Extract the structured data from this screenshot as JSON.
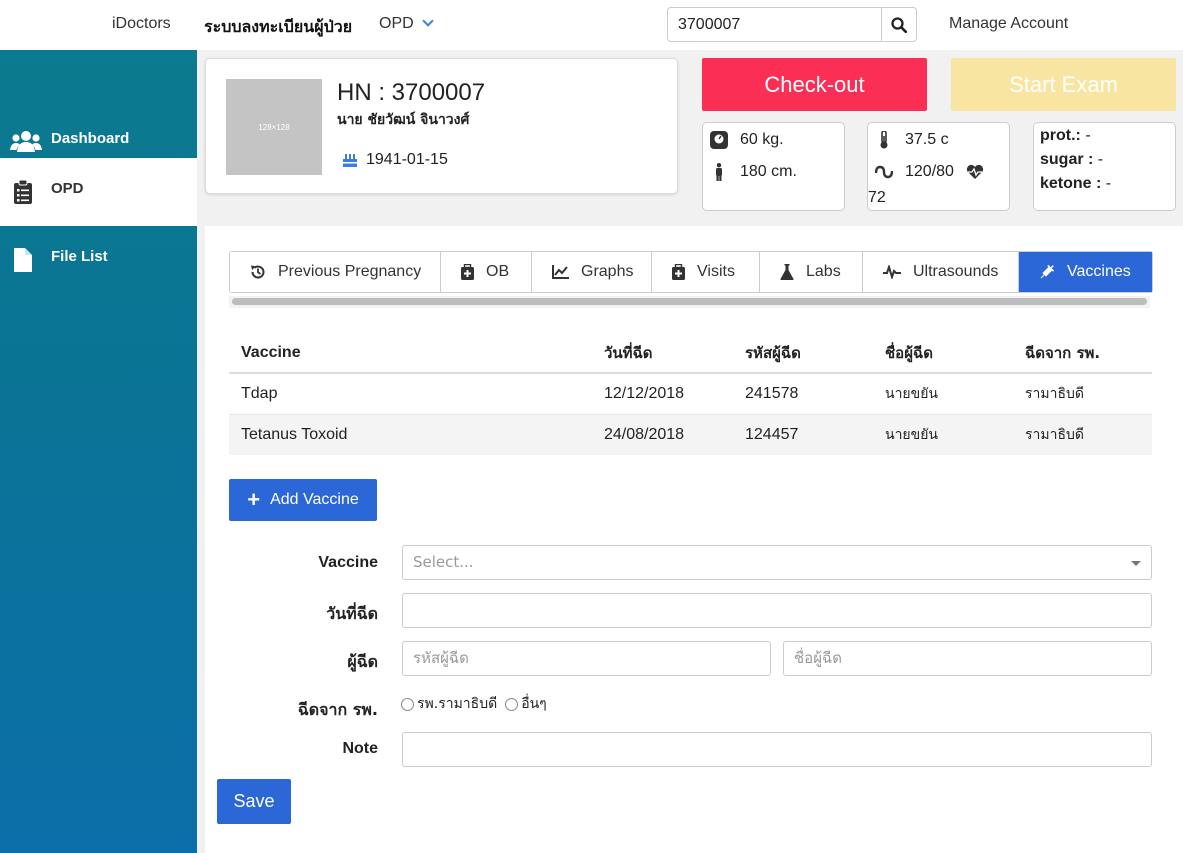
{
  "topbar": {
    "brand": "iDoctors",
    "register": "ระบบลงทะเบียนผู้ป่วย",
    "dept": "OPD",
    "search_value": "3700007",
    "manage": "Manage Account"
  },
  "sidebar": {
    "items": [
      {
        "label": "Dashboard",
        "icon": "users-icon"
      },
      {
        "label": "OPD",
        "icon": "clipboard-icon"
      },
      {
        "label": "File List",
        "icon": "file-icon"
      }
    ]
  },
  "patient": {
    "photo_placeholder": "128×128",
    "hn": "HN : 3700007",
    "name": "นาย ชัยวัฒน์ จินาวงศ์",
    "dob": "1941-01-15"
  },
  "actions": {
    "checkout": "Check-out",
    "start_exam": "Start Exam"
  },
  "vitals": {
    "weight": "60 kg.",
    "height": "180 cm.",
    "temp": "37.5 c",
    "bp": "120/80",
    "pulse": "72",
    "prot_label": "prot.:",
    "prot_value": "-",
    "sugar_label": "sugar :",
    "sugar_value": "-",
    "ketone_label": "ketone :",
    "ketone_value": "-"
  },
  "tabs": [
    {
      "label": "Previous Pregnancy",
      "icon": "history-icon"
    },
    {
      "label": "OB",
      "icon": "medkit-icon"
    },
    {
      "label": "Graphs",
      "icon": "line-chart-icon"
    },
    {
      "label": "Visits",
      "icon": "medkit-icon"
    },
    {
      "label": "Labs",
      "icon": "flask-icon"
    },
    {
      "label": "Ultrasounds",
      "icon": "heartbeat-line-icon"
    },
    {
      "label": "Vaccines",
      "icon": "syringe-icon"
    }
  ],
  "table": {
    "headers": [
      "Vaccine",
      "วันที่ฉีด",
      "รหัสผู้ฉีด",
      "ชื่อผู้ฉีด",
      "ฉีดจาก รพ."
    ],
    "rows": [
      [
        "Tdap",
        "12/12/2018",
        "241578",
        "นายขยัน",
        "รามาธิบดี"
      ],
      [
        "Tetanus Toxoid",
        "24/08/2018",
        "124457",
        "นายขยัน",
        "รามาธิบดี"
      ]
    ]
  },
  "form": {
    "add_button": "Add Vaccine",
    "vaccine_label": "Vaccine",
    "vaccine_placeholder": "Select...",
    "date_label": "วันที่ฉีด",
    "injector_label": "ผู้ฉีด",
    "injector_id_placeholder": "รหัสผู้ฉีด",
    "injector_name_placeholder": "ชื่อผู้ฉีด",
    "hospital_label": "ฉีดจาก รพ.",
    "hospital_options": [
      "รพ.รามาธิบดี",
      "อื่นๆ"
    ],
    "note_label": "Note",
    "save": "Save"
  },
  "colors": {
    "checkout": "#fb2f55",
    "start_exam": "#f9e5a2",
    "primary": "#2b67d6",
    "sidebar": "#0b7b8f"
  }
}
